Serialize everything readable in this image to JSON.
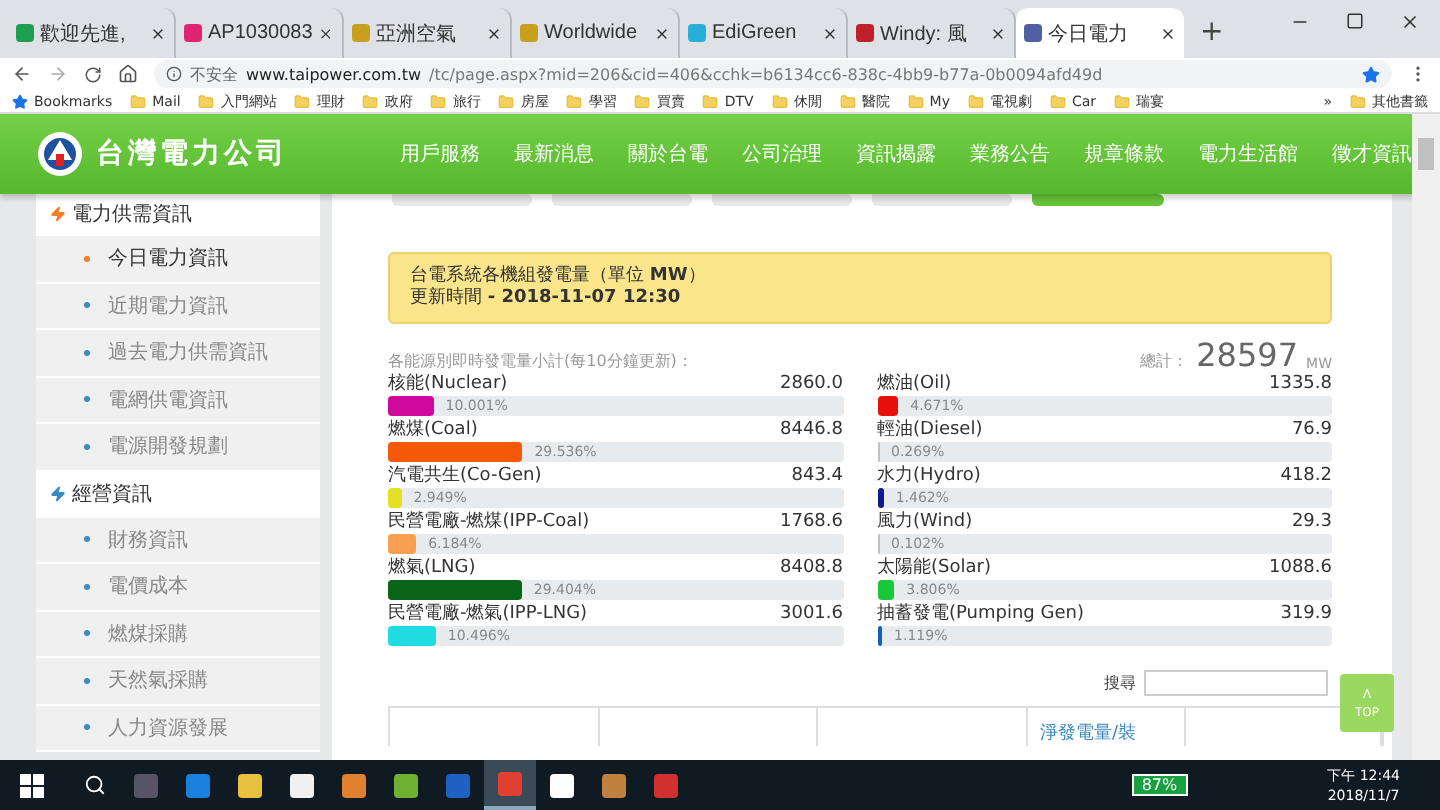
{
  "browser": {
    "tabs": [
      {
        "title": "歡迎先進,",
        "selected": false,
        "color": "#1e9e50"
      },
      {
        "title": "AP1030083",
        "selected": false,
        "color": "#e0246e"
      },
      {
        "title": "亞洲空氣",
        "selected": false,
        "color": "#c8a020"
      },
      {
        "title": "Worldwide",
        "selected": false,
        "color": "#c8a020"
      },
      {
        "title": "EdiGreen",
        "selected": false,
        "color": "#2ab0d8"
      },
      {
        "title": "Windy: 風",
        "selected": false,
        "color": "#c0202a"
      },
      {
        "title": "今日電力",
        "selected": true,
        "color": "#5060a0"
      }
    ],
    "new_tab": "+",
    "address": {
      "security": "不安全",
      "host": "www.taipower.com.tw",
      "path": "/tc/page.aspx?mid=206&cid=406&cchk=b6134cc6-838c-4bb9-b77a-0b0094afd49d"
    },
    "bookmarks": [
      {
        "label": "Bookmarks",
        "kind": "star"
      },
      {
        "label": "Mail",
        "kind": "folder"
      },
      {
        "label": "入門網站",
        "kind": "folder"
      },
      {
        "label": "理財",
        "kind": "folder"
      },
      {
        "label": "政府",
        "kind": "folder"
      },
      {
        "label": "旅行",
        "kind": "folder"
      },
      {
        "label": "房屋",
        "kind": "folder"
      },
      {
        "label": "學習",
        "kind": "folder"
      },
      {
        "label": "買賣",
        "kind": "folder"
      },
      {
        "label": "DTV",
        "kind": "folder"
      },
      {
        "label": "休閒",
        "kind": "folder"
      },
      {
        "label": "醫院",
        "kind": "folder"
      },
      {
        "label": "My",
        "kind": "folder"
      },
      {
        "label": "電視劇",
        "kind": "folder"
      },
      {
        "label": "Car",
        "kind": "folder"
      },
      {
        "label": "瑞宴",
        "kind": "folder"
      }
    ],
    "more_bookmarks": "»",
    "other_bookmarks": "其他書籤"
  },
  "site": {
    "logo_text": "台灣電力公司",
    "nav": [
      "用戶服務",
      "最新消息",
      "關於台電",
      "公司治理",
      "資訊揭露",
      "業務公告",
      "規章條款",
      "電力生活館",
      "徵才資訊"
    ]
  },
  "sidebar": [
    {
      "label": "電力供需資訊",
      "children": [
        {
          "label": "今日電力資訊",
          "selected": true
        },
        {
          "label": "近期電力資訊",
          "selected": false
        },
        {
          "label": "過去電力供需資訊",
          "selected": false
        },
        {
          "label": "電網供電資訊",
          "selected": false
        },
        {
          "label": "電源開發規劃",
          "selected": false
        }
      ]
    },
    {
      "label": "經營資訊",
      "children": [
        {
          "label": "財務資訊",
          "selected": false
        },
        {
          "label": "電價成本",
          "selected": false
        },
        {
          "label": "燃煤採購",
          "selected": false
        },
        {
          "label": "天然氣採購",
          "selected": false
        },
        {
          "label": "人力資源發展",
          "selected": false
        }
      ]
    }
  ],
  "notice": {
    "line1": "台電系統各機組發電量（單位 **MW**）",
    "line2": "更新時間 **- 2018-11-07 12:30**"
  },
  "summary": {
    "caption": "各能源別即時發電量小計(每10分鐘更新)：",
    "total_label": "總計：",
    "total": "28597",
    "unit": "MW"
  },
  "sources": [
    {
      "name": "核能(Nuclear)",
      "value": "2860.0",
      "percent": "10.001%",
      "level": 0.10001,
      "color": "#d0089c"
    },
    {
      "name": "燃油(Oil)",
      "value": "1335.8",
      "percent": "4.671%",
      "level": 0.04671,
      "color": "#e8100c"
    },
    {
      "name": "燃煤(Coal)",
      "value": "8446.8",
      "percent": "29.536%",
      "level": 0.29536,
      "color": "#f45a08"
    },
    {
      "name": "輕油(Diesel)",
      "value": "76.9",
      "percent": "0.269%",
      "level": 0.00269,
      "color": "#c0c0c0"
    },
    {
      "name": "汽電共生(Co-Gen)",
      "value": "843.4",
      "percent": "2.949%",
      "level": 0.02949,
      "color": "#e4e024"
    },
    {
      "name": "水力(Hydro)",
      "value": "418.2",
      "percent": "1.462%",
      "level": 0.01462,
      "color": "#0c1c90"
    },
    {
      "name": "民營電廠-燃煤(IPP-Coal)",
      "value": "1768.6",
      "percent": "6.184%",
      "level": 0.06184,
      "color": "#f8a050"
    },
    {
      "name": "風力(Wind)",
      "value": "29.3",
      "percent": "0.102%",
      "level": 0.00102,
      "color": "#c0c0c0"
    },
    {
      "name": "燃氣(LNG)",
      "value": "8408.8",
      "percent": "29.404%",
      "level": 0.29404,
      "color": "#0a6418"
    },
    {
      "name": "太陽能(Solar)",
      "value": "1088.6",
      "percent": "3.806%",
      "level": 0.03806,
      "color": "#18c838"
    },
    {
      "name": "民營電廠-燃氣(IPP-LNG)",
      "value": "3001.6",
      "percent": "10.496%",
      "level": 0.10496,
      "color": "#20dce0"
    },
    {
      "name": "抽蓄發電(Pumping Gen)",
      "value": "319.9",
      "percent": "1.119%",
      "level": 0.01119,
      "color": "#1060c0"
    }
  ],
  "search": {
    "label": "搜尋"
  },
  "sub_tabs": [
    {
      "selected": false
    },
    {
      "selected": false
    },
    {
      "selected": false
    },
    {
      "selected": false
    },
    {
      "selected": true
    }
  ],
  "table": {
    "header": "淨發電量/裝"
  },
  "top_button": {
    "arrow": "Λ",
    "label": "TOP"
  },
  "taskbar": {
    "battery": "87%",
    "time": "下午 12:44",
    "date": "2018/11/7"
  }
}
